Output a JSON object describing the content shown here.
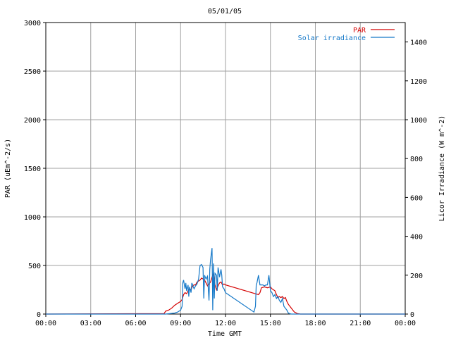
{
  "chart_data": {
    "type": "line",
    "title": "05/01/05",
    "xlabel": "Time GMT",
    "ylabel": "PAR (uEm^-2/s)",
    "y2label": "Licor Irradiance (W m^-2)",
    "xlim": [
      0,
      24
    ],
    "ylim": [
      0,
      3000
    ],
    "y2lim": [
      0,
      1500
    ],
    "x_tick_labels": [
      "00:00",
      "03:00",
      "06:00",
      "09:00",
      "12:00",
      "15:00",
      "18:00",
      "21:00",
      "00:00"
    ],
    "y_tick_labels": [
      "0",
      "500",
      "1000",
      "1500",
      "2000",
      "2500",
      "3000"
    ],
    "y2_tick_labels": [
      "0",
      "200",
      "400",
      "600",
      "800",
      "1000",
      "1200",
      "1400"
    ],
    "grid": true,
    "legend_position": "top-right",
    "series": [
      {
        "name": "PAR",
        "axis": "left",
        "color": "#d40000",
        "x": [
          0,
          7.9,
          8.0,
          8.2,
          8.4,
          8.6,
          8.8,
          9.0,
          9.1,
          9.2,
          9.3,
          9.4,
          9.5,
          9.6,
          9.7,
          9.8,
          9.9,
          10.0,
          10.1,
          10.2,
          10.3,
          10.4,
          10.5,
          10.6,
          10.7,
          10.8,
          10.9,
          11.0,
          11.1,
          11.2,
          11.3,
          11.4,
          11.5,
          11.6,
          11.7,
          11.8,
          11.9,
          12.0,
          14.2,
          14.3,
          14.4,
          14.6,
          14.8,
          15.0,
          15.1,
          15.2,
          15.3,
          15.4,
          15.5,
          15.6,
          15.7,
          15.8,
          15.9,
          16.0,
          16.1,
          16.2,
          16.3,
          16.4,
          16.5,
          16.6,
          16.8,
          17.0,
          24
        ],
        "values": [
          0,
          5,
          30,
          40,
          60,
          90,
          110,
          130,
          150,
          200,
          220,
          210,
          240,
          260,
          250,
          290,
          300,
          300,
          330,
          340,
          350,
          370,
          360,
          350,
          320,
          290,
          310,
          330,
          380,
          420,
          300,
          250,
          290,
          320,
          330,
          300,
          310,
          300,
          200,
          220,
          270,
          280,
          270,
          280,
          260,
          250,
          240,
          200,
          170,
          180,
          170,
          180,
          160,
          170,
          130,
          100,
          80,
          60,
          40,
          20,
          5,
          0,
          0
        ]
      },
      {
        "name": "Solar irradiance",
        "axis": "right",
        "color": "#1478c8",
        "x": [
          0,
          8.0,
          8.6,
          8.8,
          9.0,
          9.1,
          9.15,
          9.2,
          9.3,
          9.35,
          9.4,
          9.5,
          9.55,
          9.6,
          9.7,
          9.75,
          9.8,
          9.9,
          10.0,
          10.1,
          10.2,
          10.3,
          10.4,
          10.5,
          10.55,
          10.6,
          10.7,
          10.8,
          10.9,
          10.95,
          11.0,
          11.1,
          11.15,
          11.2,
          11.25,
          11.3,
          11.4,
          11.45,
          11.5,
          11.55,
          11.6,
          11.7,
          11.75,
          11.8,
          11.9,
          12.0,
          13.9,
          14.0,
          14.05,
          14.1,
          14.2,
          14.3,
          14.4,
          14.5,
          14.6,
          14.7,
          14.8,
          14.9,
          15.0,
          15.1,
          15.2,
          15.3,
          15.4,
          15.5,
          15.6,
          15.7,
          15.8,
          15.9,
          16.0,
          16.1,
          16.2,
          16.3,
          16.4,
          24
        ],
        "values": [
          0,
          0,
          5,
          10,
          20,
          40,
          160,
          175,
          130,
          160,
          120,
          150,
          90,
          140,
          110,
          160,
          150,
          130,
          145,
          155,
          180,
          250,
          255,
          240,
          80,
          200,
          180,
          195,
          70,
          230,
          280,
          340,
          20,
          260,
          80,
          210,
          200,
          120,
          240,
          220,
          190,
          230,
          200,
          140,
          130,
          110,
          10,
          40,
          150,
          160,
          200,
          150,
          150,
          150,
          145,
          150,
          150,
          200,
          120,
          110,
          90,
          100,
          80,
          90,
          70,
          60,
          80,
          40,
          30,
          20,
          5,
          2,
          0,
          0
        ]
      }
    ]
  }
}
